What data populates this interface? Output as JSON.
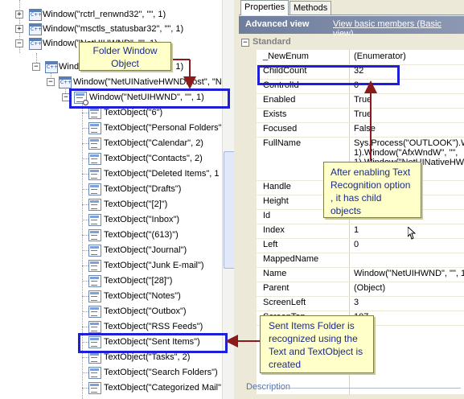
{
  "tree": {
    "items": [
      {
        "label": "Window(\"rctrl_renwnd32\", \"\", 1)"
      },
      {
        "label": "Window(\"msctls_statusbar32\", \"\", 1)"
      },
      {
        "label": "Window(\"NetUIHWND\", \"\", 1)"
      },
      {
        "label": "Window(\"MsoCommandBar\", 1)"
      },
      {
        "label": "Window(\"NetUINativeHWNDHost\", \"NU"
      },
      {
        "label": "Window(\"NetUIHWND\", \"\", 1)"
      },
      {
        "label": "TextObject(\"6\")"
      },
      {
        "label": "TextObject(\"Personal Folders\""
      },
      {
        "label": "TextObject(\"Calendar\", 2)"
      },
      {
        "label": "TextObject(\"Contacts\", 2)"
      },
      {
        "label": "TextObject(\"Deleted Items\", 1"
      },
      {
        "label": "TextObject(\"Drafts\")"
      },
      {
        "label": "TextObject(\"[2]\")"
      },
      {
        "label": "TextObject(\"Inbox\")"
      },
      {
        "label": "TextObject(\"(613)\")"
      },
      {
        "label": "TextObject(\"Journal\")"
      },
      {
        "label": "TextObject(\"Junk E-mail\")"
      },
      {
        "label": "TextObject(\"[28]\")"
      },
      {
        "label": "TextObject(\"Notes\")"
      },
      {
        "label": "TextObject(\"Outbox\")"
      },
      {
        "label": "TextObject(\"RSS Feeds\")"
      },
      {
        "label": "TextObject(\"Sent Items\")"
      },
      {
        "label": "TextObject(\"Tasks\", 2)"
      },
      {
        "label": "TextObject(\"Search Folders\")"
      },
      {
        "label": "TextObject(\"Categorized Mail\""
      }
    ]
  },
  "panel": {
    "tabs": [
      "Properties",
      "Methods"
    ],
    "header_title": "Advanced view",
    "basic_link": "View basic members (Basic view)",
    "category": "Standard",
    "rows": [
      {
        "name": "_NewEnum",
        "value": "(Enumerator)"
      },
      {
        "name": "ChildCount",
        "value": "32"
      },
      {
        "name": "ControlId",
        "value": "0"
      },
      {
        "name": "Enabled",
        "value": "True"
      },
      {
        "name": "Exists",
        "value": "True"
      },
      {
        "name": "Focused",
        "value": "False"
      },
      {
        "name": "FullName",
        "value": "Sys.Process(\"OUTLOOK\").W",
        "value2": "1).Window(\"AfxWndW\", \"\",",
        "value3": "1).Window(\"NetUINativeHW"
      },
      {
        "name": "Handle",
        "value": ""
      },
      {
        "name": "Height",
        "value": ""
      },
      {
        "name": "Id",
        "value": ""
      },
      {
        "name": "Index",
        "value": "1"
      },
      {
        "name": "Left",
        "value": "0"
      },
      {
        "name": "MappedName",
        "value": ""
      },
      {
        "name": "Name",
        "value": "Window(\"NetUIHWND\", \"\", 1"
      },
      {
        "name": "Parent",
        "value": "(Object)"
      },
      {
        "name": "ScreenLeft",
        "value": "3"
      },
      {
        "name": "ScreenTop",
        "value": "107"
      }
    ],
    "description_label": "Description"
  },
  "callouts": {
    "folder_window": "Folder Window Object",
    "text_recognition": "After enabling Text Recognition option , it has child objects",
    "sent_items": "Sent Items Folder is recognized using the Text and  TextObject is created"
  },
  "colors": {
    "highlight_border": "#1d20d8",
    "callout_bg": "#ffffc9",
    "arrow": "#8b1a1a"
  }
}
